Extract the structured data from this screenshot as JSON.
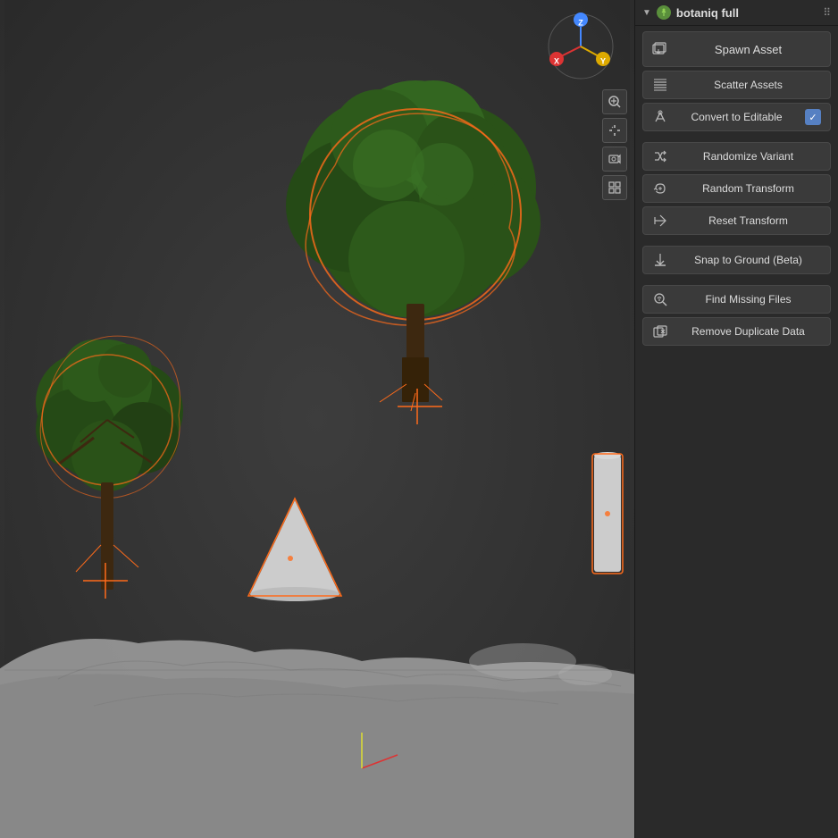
{
  "panel": {
    "title": "botaniq full",
    "icon_label": "🌿",
    "collapse_arrow": "▼",
    "dots": "⠿",
    "buttons": [
      {
        "id": "spawn-asset",
        "label": "Spawn Asset",
        "icon": "spawn",
        "large": true,
        "has_checkbox": false
      },
      {
        "id": "scatter-assets",
        "label": "Scatter Assets",
        "icon": "scatter",
        "large": false,
        "has_checkbox": false
      },
      {
        "id": "convert-to-editable",
        "label": "Convert to Editable",
        "icon": "convert",
        "large": false,
        "has_checkbox": true,
        "checkbox_checked": true
      },
      {
        "id": "divider1",
        "type": "divider"
      },
      {
        "id": "randomize-variant",
        "label": "Randomize Variant",
        "icon": "random",
        "large": false,
        "has_checkbox": false
      },
      {
        "id": "random-transform",
        "label": "Random Transform",
        "icon": "transform",
        "large": false,
        "has_checkbox": false
      },
      {
        "id": "reset-transform",
        "label": "Reset Transform",
        "icon": "reset",
        "large": false,
        "has_checkbox": false
      },
      {
        "id": "divider2",
        "type": "divider"
      },
      {
        "id": "snap-to-ground",
        "label": "Snap to Ground (Beta)",
        "icon": "snap",
        "large": false,
        "has_checkbox": false
      },
      {
        "id": "divider3",
        "type": "divider"
      },
      {
        "id": "find-missing-files",
        "label": "Find Missing Files",
        "icon": "find",
        "large": false,
        "has_checkbox": false
      },
      {
        "id": "remove-duplicate-data",
        "label": "Remove Duplicate Data",
        "icon": "remove",
        "large": false,
        "has_checkbox": false
      }
    ]
  },
  "viewport": {
    "gizmo": {
      "x_label": "X",
      "y_label": "Y",
      "z_label": "Z"
    },
    "controls": [
      "zoom",
      "hand",
      "camera",
      "grid"
    ]
  }
}
